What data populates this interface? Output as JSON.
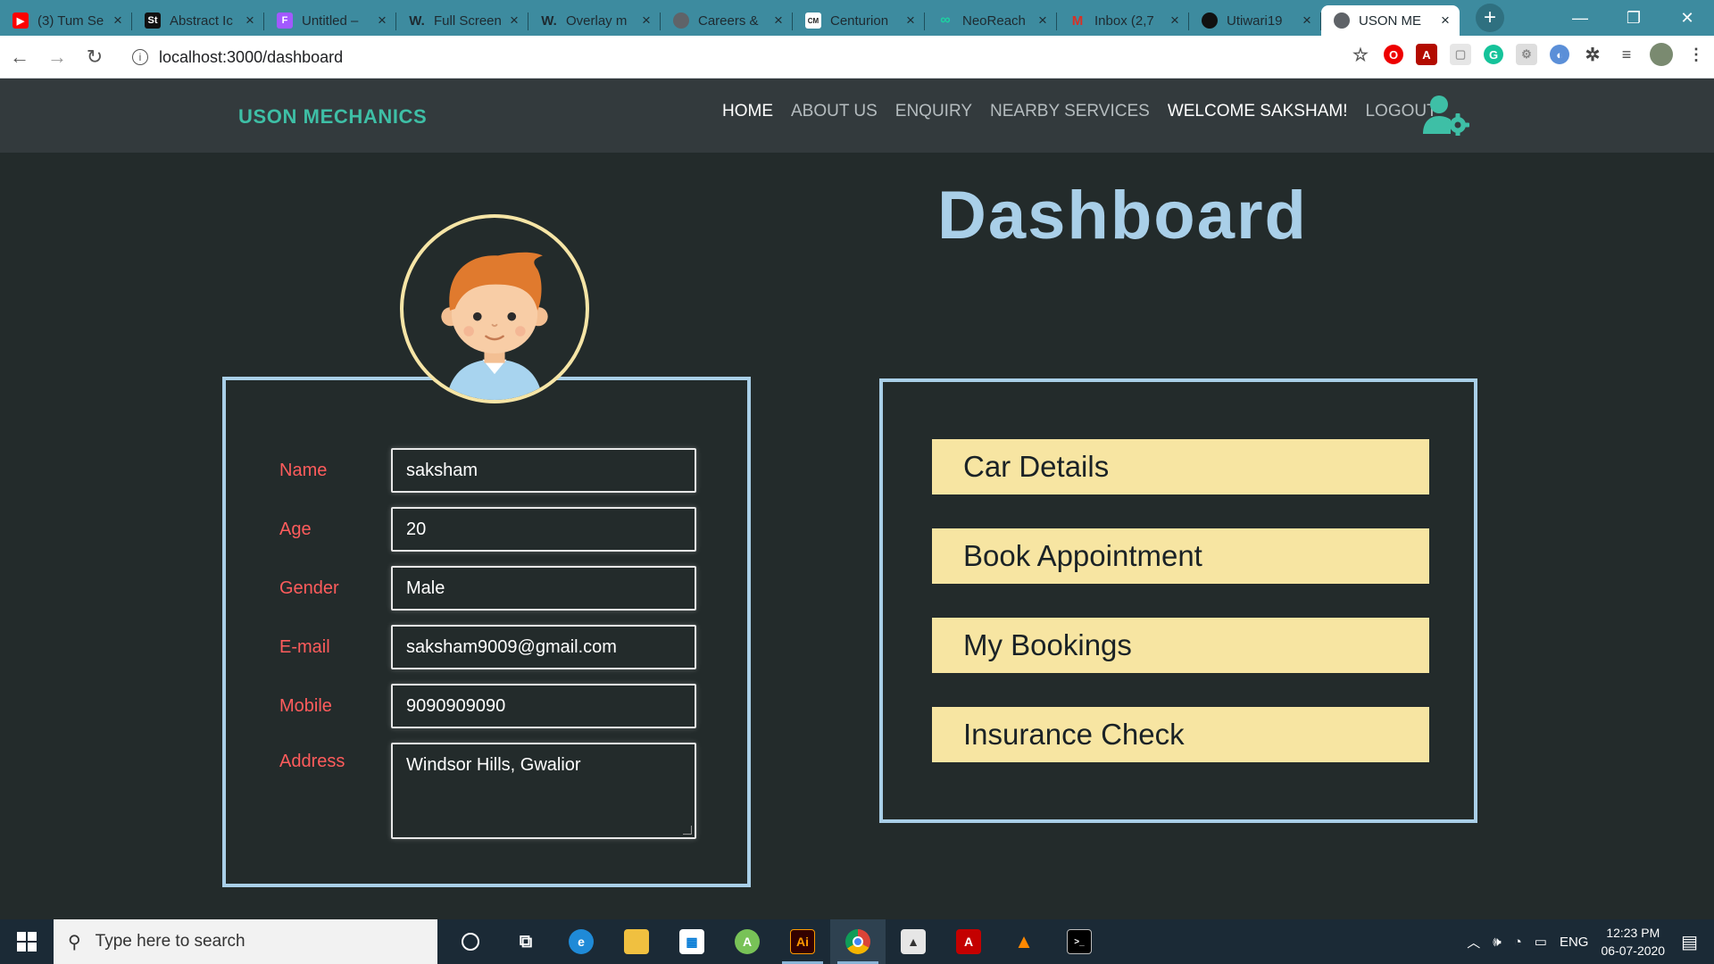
{
  "browser": {
    "tabs": [
      {
        "label": "(3) Tum Se",
        "icon": "youtube-icon",
        "color": "#ff0000",
        "glyph": "▶"
      },
      {
        "label": "Abstract Ic",
        "icon": "st-icon",
        "color": "#111111",
        "glyph": "St"
      },
      {
        "label": "Untitled –",
        "icon": "figma-icon",
        "color": "#a259ff",
        "glyph": "F"
      },
      {
        "label": "Full Screen",
        "icon": "w-icon",
        "color": "#3d8b9f",
        "glyph": "W."
      },
      {
        "label": "Overlay m",
        "icon": "w-icon",
        "color": "#3d8b9f",
        "glyph": "W."
      },
      {
        "label": "Careers &",
        "icon": "globe-icon",
        "color": "#5f6368",
        "glyph": "◍"
      },
      {
        "label": "Centurion",
        "icon": "cm-icon",
        "color": "#ffffff",
        "glyph": "CM"
      },
      {
        "label": "NeoReach",
        "icon": "neoreach-icon",
        "color": "#1dd1a1",
        "glyph": "∞"
      },
      {
        "label": "Inbox (2,7",
        "icon": "gmail-icon",
        "color": "#d93025",
        "glyph": "M"
      },
      {
        "label": "Utiwari19",
        "icon": "github-icon",
        "color": "#111111",
        "glyph": "●"
      },
      {
        "label": "USON ME",
        "icon": "globe-icon",
        "color": "#5f6368",
        "glyph": "◍",
        "active": true
      }
    ],
    "url": "localhost:3000/dashboard"
  },
  "site": {
    "brand": "USON MECHANICS",
    "nav": {
      "home": "HOME",
      "about": "ABOUT US",
      "enquiry": "ENQUIRY",
      "nearby": "NEARBY SERVICES",
      "welcome": "WELCOME SAKSHAM!",
      "logout": "LOGOUT"
    }
  },
  "dashboard": {
    "title": "Dashboard",
    "profile": {
      "fields": [
        {
          "label": "Name",
          "value": "saksham"
        },
        {
          "label": "Age",
          "value": "20"
        },
        {
          "label": "Gender",
          "value": "Male"
        },
        {
          "label": "E-mail",
          "value": "saksham9009@gmail.com"
        },
        {
          "label": "Mobile",
          "value": "9090909090"
        },
        {
          "label": "Address",
          "value": "Windsor Hills, Gwalior"
        }
      ]
    },
    "actions": [
      "Car Details",
      "Book Appointment",
      "My Bookings",
      "Insurance Check"
    ]
  },
  "taskbar": {
    "search_placeholder": "Type here to search",
    "language": "ENG",
    "time": "12:23 PM",
    "date": "06-07-2020"
  },
  "colors": {
    "brand": "#3ebfa6",
    "accent_blue": "#a9cfe8",
    "button_yellow": "#f7e5a2",
    "label_red": "#ff5c5c",
    "background": "#232b2b"
  }
}
